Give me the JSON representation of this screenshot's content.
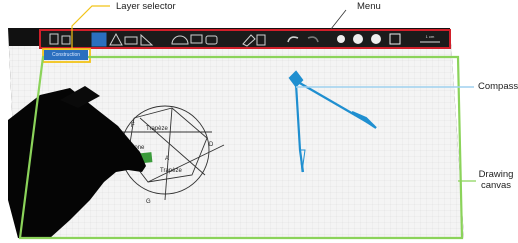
{
  "annotations": {
    "layer_selector": "Layer selector",
    "menu": "Menu",
    "compass": "Compass",
    "drawing_canvas_line1": "Drawing",
    "drawing_canvas_line2": "canvas"
  },
  "toolbar": {
    "active_layer_label": "Construction",
    "scale_label": "1 cm"
  },
  "canvas_labels": {
    "trapeze_top": "Trapèze",
    "polygone": "polygone",
    "trapeze_bottom": "Trapèze",
    "point_a": "A",
    "point_d": "D",
    "point_g": "G",
    "point_f": "F"
  },
  "colors": {
    "menu_border": "#d11f2a",
    "layer_border": "#f2c418",
    "canvas_border": "#8bd35a",
    "compass": "#1f8fd0",
    "toolbar_bg": "#1b1b1b",
    "grid_line": "#d9d9d9"
  }
}
